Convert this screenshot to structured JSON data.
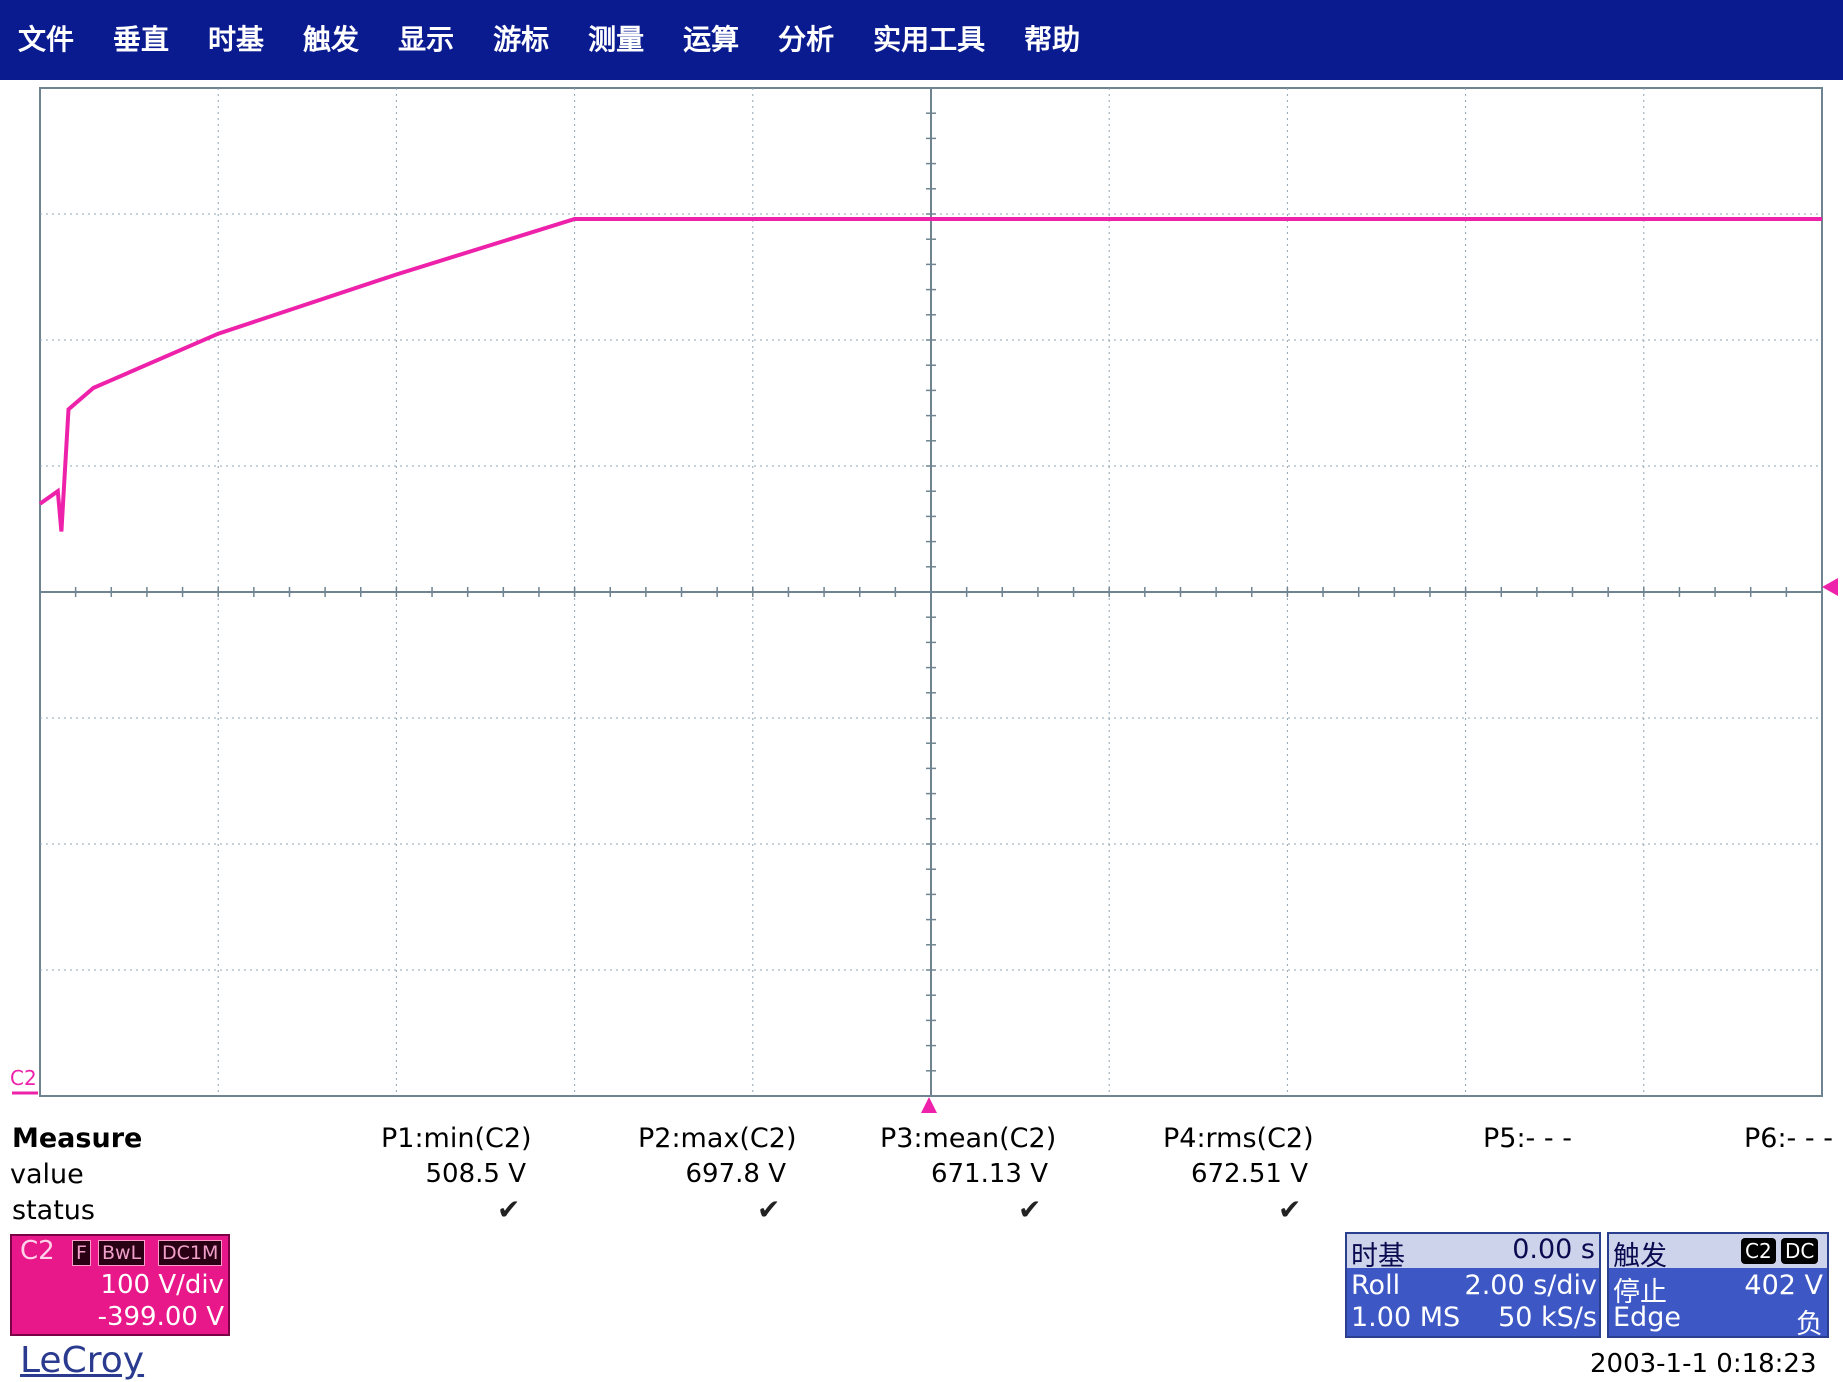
{
  "menu": [
    "文件",
    "垂直",
    "时基",
    "触发",
    "显示",
    "游标",
    "测量",
    "运算",
    "分析",
    "实用工具",
    "帮助"
  ],
  "colors": {
    "menubar": "#0a1a8f",
    "trace": "#ee22aa",
    "grid": "#8fa4b0",
    "channel_badge": "#e8178a",
    "panel_blue": "#3d58c5"
  },
  "scope": {
    "channel_marker": "C2",
    "trace_points": [
      {
        "t": 0.0,
        "v": 0.7
      },
      {
        "t": 0.1,
        "v": 0.8
      },
      {
        "t": 0.12,
        "v": 0.48
      },
      {
        "t": 0.16,
        "v": 1.45
      },
      {
        "t": 0.3,
        "v": 1.62
      },
      {
        "t": 1.0,
        "v": 2.05
      },
      {
        "t": 2.0,
        "v": 2.52
      },
      {
        "t": 3.0,
        "v": 2.96
      },
      {
        "t": 10.0,
        "v": 2.96
      }
    ]
  },
  "measure": {
    "header": "Measure",
    "row_value": "value",
    "row_status": "status",
    "params": [
      {
        "label": "P1:min(C2)",
        "value": "508.5 V",
        "ok": true
      },
      {
        "label": "P2:max(C2)",
        "value": "697.8 V",
        "ok": true
      },
      {
        "label": "P3:mean(C2)",
        "value": "671.13 V",
        "ok": true
      },
      {
        "label": "P4:rms(C2)",
        "value": "672.51 V",
        "ok": true
      },
      {
        "label": "P5:- - -",
        "value": "",
        "ok": false
      },
      {
        "label": "P6:- - -",
        "value": "",
        "ok": false
      }
    ],
    "check_glyph": "✔"
  },
  "channel": {
    "name": "C2",
    "tags": [
      "F",
      "BwL",
      "DC1M"
    ],
    "vdiv": "100 V/div",
    "offset": "-399.00 V"
  },
  "timebase": {
    "title": "时基",
    "delay": "0.00 s",
    "mode": "Roll",
    "tdiv": "2.00 s/div",
    "samples": "1.00 MS",
    "rate": "50 kS/s"
  },
  "trigger": {
    "title": "触发",
    "tags": [
      "C2",
      "DC"
    ],
    "state": "停止",
    "level": "402 V",
    "type": "Edge",
    "slope": "负"
  },
  "brand": "LeCroy",
  "datetime": "2003-1-1 0:18:23"
}
